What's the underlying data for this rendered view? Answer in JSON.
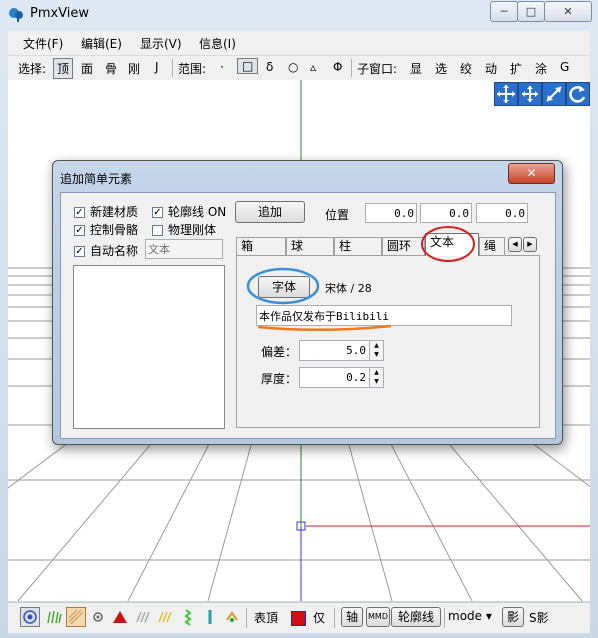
{
  "app": {
    "title": "PmxView"
  },
  "window_buttons": {
    "minimize": "─",
    "maximize": "□",
    "close": "✕"
  },
  "menubar": {
    "items": [
      "文件(F)",
      "编辑(E)",
      "显示(V)",
      "信息(I)"
    ]
  },
  "toolbar": {
    "select_label": "选择:",
    "select_items": [
      "顶",
      "面",
      "骨",
      "刚",
      "J"
    ],
    "range_label": "范围:",
    "range_items": [
      "·",
      "□",
      "δ",
      "○",
      "▵",
      "Φ"
    ],
    "subwindow_label": "子窗口:",
    "subwindow_items": [
      "显",
      "选",
      "绞",
      "动",
      "扩",
      "涂",
      "G"
    ]
  },
  "dialog": {
    "title": "追加简单元素",
    "close": "✕",
    "checkboxes": {
      "new_material": {
        "label": "新建材质",
        "checked": true
      },
      "outline": {
        "label": "轮廓线 ON",
        "checked": true
      },
      "control_bone": {
        "label": "控制骨骼",
        "checked": true
      },
      "physics": {
        "label": "物理刚体",
        "checked": false
      },
      "auto_name": {
        "label": "自动名称",
        "checked": true
      }
    },
    "auto_name_placeholder": "文本",
    "add_button": "追加",
    "position_label": "位置",
    "position": [
      "0.0",
      "0.0",
      "0.0"
    ],
    "tabs": [
      "箱",
      "球",
      "柱",
      "圆环",
      "文本",
      "绳"
    ],
    "active_tab": "文本",
    "font_button": "字体",
    "font_info": "宋体 / 28",
    "text_value": "本作品仅发布于Bilibili",
    "offset_label": "偏差：",
    "offset_value": "5.0",
    "thickness_label": "厚度：",
    "thickness_value": "0.2"
  },
  "bottombar": {
    "surface_label": "表頂",
    "only_label": "仅",
    "axis_label": "轴",
    "mmd_label": "MMD",
    "outline_label": "轮廓线",
    "mode_label": "mode ▾",
    "shadow_label": "影",
    "sshadow_label": "S影"
  },
  "colors": {
    "accent_red": "#cc0000",
    "annotation_blue": "#3b8fd6",
    "annotation_orange": "#f07a1a",
    "green_axis": "#2e8b2e"
  }
}
